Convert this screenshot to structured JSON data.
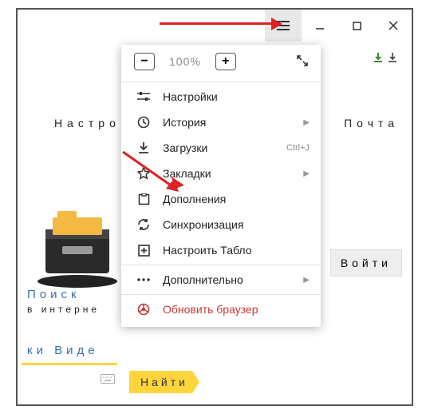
{
  "zoom": {
    "level": "100%"
  },
  "menu": {
    "settings": "Настройки",
    "history": "История",
    "downloads": "Загрузки",
    "downloads_shortcut": "Ctrl+J",
    "bookmarks": "Закладки",
    "addons": "Дополнения",
    "sync": "Синхронизация",
    "configure_dashboard": "Настроить Табло",
    "more": "Дополнительно",
    "update": "Обновить браузер"
  },
  "page": {
    "settings_bg": "Настро",
    "mail": "Почта",
    "login": "Войти",
    "search": "Поиск",
    "internet": "в интерне",
    "links": "ки Виде",
    "find": "Найти"
  }
}
